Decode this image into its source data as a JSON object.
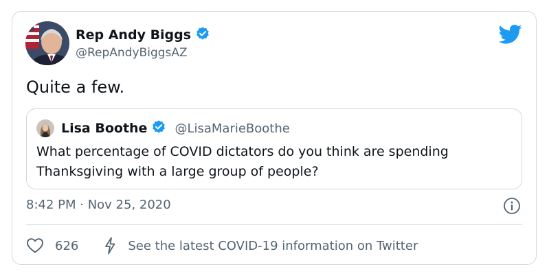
{
  "tweet": {
    "author": {
      "name": "Rep Andy Biggs",
      "handle": "@RepAndyBiggsAZ",
      "verified": true
    },
    "text": "Quite a few.",
    "quoted": {
      "author": {
        "name": "Lisa Boothe",
        "handle": "@LisaMarieBoothe",
        "verified": true
      },
      "text": "What percentage of COVID dictators do you think are spending Thanksgiving with a large group of people?"
    },
    "timestamp": "8:42 PM · Nov 25, 2020",
    "likes": "626",
    "covid_notice": "See the latest COVID-19 information on Twitter"
  },
  "icons": {
    "brand": "twitter-bird-icon",
    "verified": "verified-badge-icon",
    "info": "info-icon",
    "like": "heart-icon",
    "covid": "bolt-icon"
  },
  "colors": {
    "brand_blue": "#1d9bf0",
    "text": "#0f1419",
    "secondary": "#536471",
    "border": "#cfd9de"
  }
}
